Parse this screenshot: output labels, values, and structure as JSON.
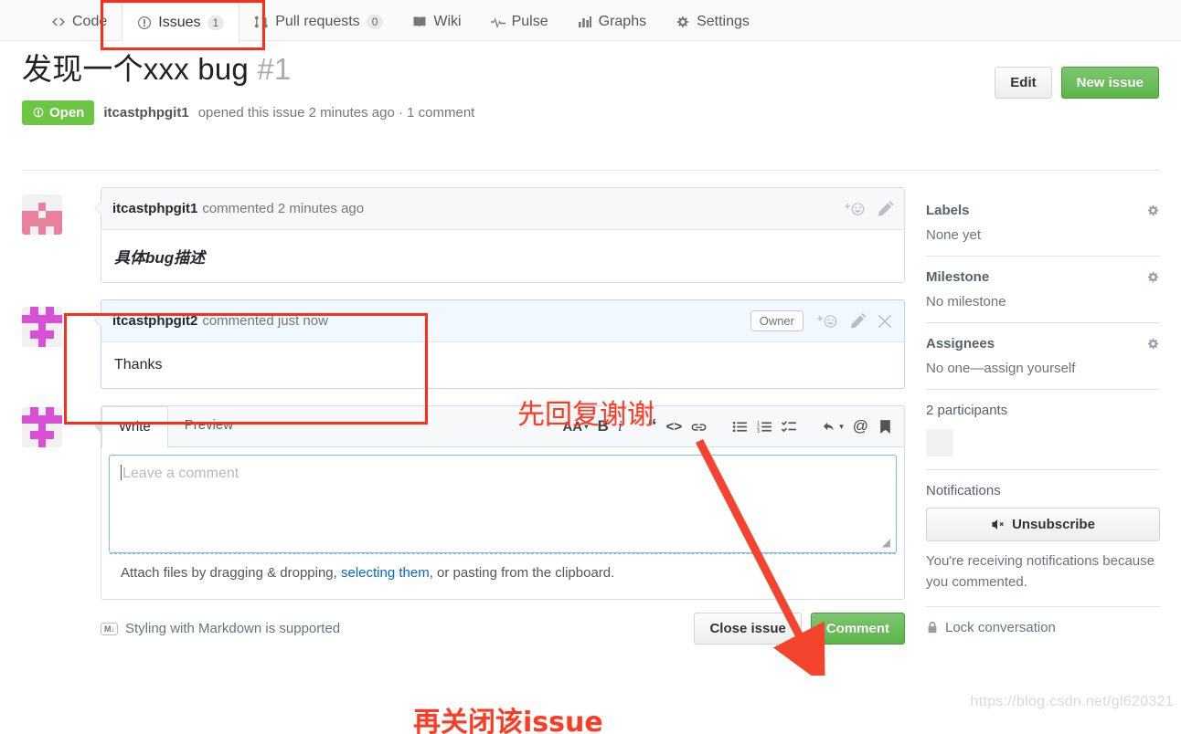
{
  "nav": {
    "tabs": [
      {
        "label": "Code",
        "icon": "code-icon",
        "count": null,
        "active": false
      },
      {
        "label": "Issues",
        "icon": "issue-opened-icon",
        "count": "1",
        "active": true
      },
      {
        "label": "Pull requests",
        "icon": "git-pull-request-icon",
        "count": "0",
        "active": false
      },
      {
        "label": "Wiki",
        "icon": "book-icon",
        "count": null,
        "active": false
      },
      {
        "label": "Pulse",
        "icon": "pulse-icon",
        "count": null,
        "active": false
      },
      {
        "label": "Graphs",
        "icon": "graph-icon",
        "count": null,
        "active": false
      },
      {
        "label": "Settings",
        "icon": "gear-icon",
        "count": null,
        "active": false
      }
    ]
  },
  "issue": {
    "title": "发现一个xxx bug",
    "number": "#1",
    "state": "Open",
    "meta_author": "itcastphpgit1",
    "meta_text": "opened this issue 2 minutes ago · 1 comment",
    "edit_label": "Edit",
    "new_issue_label": "New issue"
  },
  "comments": [
    {
      "author": "itcastphpgit1",
      "meta": "commented 2 minutes ago",
      "body": "具体bug描述",
      "owner_tag": null,
      "has_close": false
    },
    {
      "author": "itcastphpgit2",
      "meta": "commented just now",
      "body": "Thanks",
      "owner_tag": "Owner",
      "has_close": true
    }
  ],
  "form": {
    "tabs": [
      {
        "label": "Write",
        "selected": true
      },
      {
        "label": "Preview",
        "selected": false
      }
    ],
    "toolbar": [
      {
        "name": "text-size-icon",
        "glyph": "AA"
      },
      {
        "name": "bold-icon",
        "glyph": "B"
      },
      {
        "name": "italic-icon",
        "glyph": "i"
      },
      {
        "name": "quote-icon",
        "glyph": "“"
      },
      {
        "name": "code-icon",
        "glyph": "<>"
      },
      {
        "name": "link-icon",
        "glyph": "link"
      },
      {
        "name": "unordered-list-icon",
        "glyph": "ul"
      },
      {
        "name": "ordered-list-icon",
        "glyph": "ol"
      },
      {
        "name": "task-list-icon",
        "glyph": "task"
      },
      {
        "name": "reply-icon",
        "glyph": "reply"
      },
      {
        "name": "mention-icon",
        "glyph": "@"
      },
      {
        "name": "saved-replies-icon",
        "glyph": "bookmark"
      }
    ],
    "textarea_placeholder": "Leave a comment",
    "textarea_value": "",
    "dropzone_prefix": "Attach files by dragging & dropping, ",
    "dropzone_link": "selecting them",
    "dropzone_suffix": ", or pasting from the clipboard.",
    "markdown_note": "Styling with Markdown is supported",
    "markdown_badge": "M↓",
    "close_issue_label": "Close issue",
    "comment_label": "Comment"
  },
  "sidebar": {
    "labels": {
      "title": "Labels",
      "value": "None yet"
    },
    "milestone": {
      "title": "Milestone",
      "value": "No milestone"
    },
    "assignees": {
      "title": "Assignees",
      "value": "No one—assign yourself"
    },
    "participants": {
      "title": "2 participants"
    },
    "notifications": {
      "title": "Notifications",
      "button": "Unsubscribe",
      "note": "You're receiving notifications because you commented."
    },
    "lock": {
      "label": "Lock conversation"
    }
  },
  "annotations": {
    "reply_first": "先回复谢谢",
    "then_close": "再关闭该issue"
  },
  "watermark": "https://blog.csdn.net/gl620321",
  "colors": {
    "green": "#6cc644",
    "orange": "#f9a03c",
    "annotation_red": "#ff3a22",
    "link_blue": "#0366d6"
  }
}
